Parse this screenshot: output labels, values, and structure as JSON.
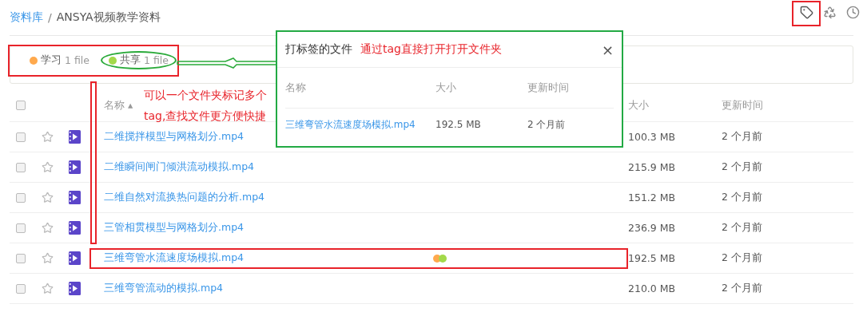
{
  "breadcrumb": [
    {
      "label": "资料库",
      "kind": "link"
    },
    {
      "label": "/",
      "kind": "separator"
    },
    {
      "label": "ANSYA视频教学资料",
      "kind": "current"
    }
  ],
  "toolbar": [
    {
      "kind": "tag",
      "selected": true
    },
    {
      "kind": "recycle",
      "selected": false
    },
    {
      "kind": "history",
      "selected": false
    }
  ],
  "tag_filters": [
    {
      "label": "学习",
      "count": "1 file",
      "color": "#ffa94d",
      "selected": false
    },
    {
      "label": "共享",
      "count": "1 file",
      "color": "#a3d94a",
      "selected": true
    }
  ],
  "table": {
    "select_all": {
      "checked": false
    },
    "sort_mark": "▴",
    "columns": [
      "名称",
      "大小",
      "更新时间"
    ],
    "rows": [
      {
        "name": "二维搅拌模型与网格划分.mp4",
        "size": "100.3 MB",
        "updated": "2 个月前",
        "checked": false,
        "starred": false,
        "tags": []
      },
      {
        "name": "二维瞬间闸门倾洪流动模拟.mp4",
        "size": "215.9 MB",
        "updated": "2 个月前",
        "checked": false,
        "starred": false,
        "tags": []
      },
      {
        "name": "二维自然对流换热问题的分析.mp4",
        "size": "151.2 MB",
        "updated": "2 个月前",
        "checked": false,
        "starred": false,
        "tags": []
      },
      {
        "name": "三管相贯模型与网格划分.mp4",
        "size": "236.9 MB",
        "updated": "2 个月前",
        "checked": false,
        "starred": false,
        "tags": []
      },
      {
        "name": "三维弯管水流速度场模拟.mp4",
        "size": "192.5 MB",
        "updated": "2 个月前",
        "checked": false,
        "starred": false,
        "highlighted": true,
        "tags": [
          {
            "color": "#ffa94d"
          },
          {
            "color": "#a3d94a"
          }
        ]
      },
      {
        "name": "三维弯管流动的模拟.mp4",
        "size": "210.0 MB",
        "updated": "2 个月前",
        "checked": false,
        "starred": false,
        "tags": []
      }
    ]
  },
  "popup": {
    "title": "打标签的文件",
    "close": "×",
    "columns": [
      "名称",
      "大小",
      "更新时间"
    ],
    "rows": [
      {
        "name": "三维弯管水流速度场模拟.mp4",
        "size": "192.5 MB",
        "updated": "2 个月前"
      }
    ]
  },
  "annotations": [
    {
      "kind": "popup-note",
      "text": "通过tag直接打开打开文件夹"
    },
    {
      "kind": "side-note",
      "text": "可以一个文件夹标记多个tag,查找文件更方便快捷"
    }
  ]
}
